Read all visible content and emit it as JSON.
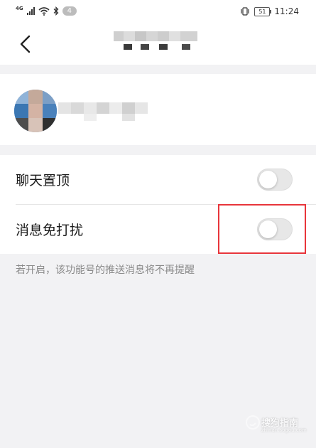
{
  "status_bar": {
    "network": "4G",
    "notification_count": "4",
    "battery": "51",
    "time": "11:24"
  },
  "header": {
    "back_icon": "chevron-left-icon"
  },
  "settings": {
    "items": [
      {
        "label": "聊天置顶",
        "enabled": false
      },
      {
        "label": "消息免打扰",
        "enabled": false
      }
    ],
    "hint": "若开启，该功能号的推送消息将不再提醒"
  },
  "watermark": {
    "text": "搜狗指南",
    "url": "zhinan.sogou.com"
  },
  "colors": {
    "highlight_border": "#e8353b",
    "toggle_off": "#e7e7e7",
    "background": "#f2f2f4"
  }
}
